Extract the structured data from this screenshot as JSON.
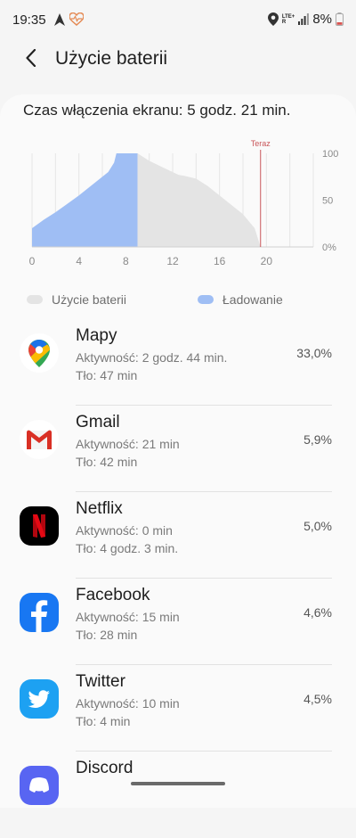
{
  "status_bar": {
    "time": "19:35",
    "network": "LTE+ R",
    "battery_percent": "8%",
    "icons": [
      "navigation-arrow-icon",
      "health-heart-icon",
      "location-icon",
      "signal-icon",
      "battery-low-icon"
    ]
  },
  "header": {
    "title": "Użycie baterii",
    "back_icon": "back-arrow-icon"
  },
  "screen_on": "Czas włączenia ekranu: 5 godz. 21 min.",
  "chart_data": {
    "type": "area",
    "x_ticks": [
      "0",
      "4",
      "8",
      "12",
      "16",
      "20"
    ],
    "y_ticks": [
      "100",
      "50",
      "0%"
    ],
    "xlim": [
      0,
      24
    ],
    "ylim": [
      0,
      100
    ],
    "now_label": "Teraz",
    "now_x": 19.5,
    "series": [
      {
        "name": "Ładowanie",
        "color": "#9fbef4",
        "x": [
          0,
          1,
          2,
          3,
          4,
          5,
          6,
          6.5,
          7,
          7.2,
          9
        ],
        "y": [
          20,
          29,
          37,
          46,
          55,
          65,
          75,
          80,
          90,
          100,
          100
        ]
      },
      {
        "name": "Użycie baterii",
        "color": "#e4e4e4",
        "x": [
          9,
          10,
          11,
          11.5,
          12,
          12.5,
          13,
          14,
          15,
          16,
          17,
          18,
          19,
          19.5
        ],
        "y": [
          100,
          92,
          86,
          83,
          80,
          77,
          76,
          73,
          65,
          55,
          45,
          35,
          20,
          0
        ]
      }
    ]
  },
  "legend": [
    {
      "label": "Użycie baterii",
      "color": "#e4e4e4"
    },
    {
      "label": "Ładowanie",
      "color": "#9fbef4"
    }
  ],
  "apps": [
    {
      "name": "Mapy",
      "active": "Aktywność: 2 godz. 44 min.",
      "background": "Tło: 47 min",
      "percent": "33,0%",
      "icon": "google-maps-icon"
    },
    {
      "name": "Gmail",
      "active": "Aktywność: 21 min",
      "background": "Tło: 42 min",
      "percent": "5,9%",
      "icon": "gmail-icon"
    },
    {
      "name": "Netflix",
      "active": "Aktywność: 0 min",
      "background": "Tło: 4 godz. 3 min.",
      "percent": "5,0%",
      "icon": "netflix-icon"
    },
    {
      "name": "Facebook",
      "active": "Aktywność: 15 min",
      "background": "Tło: 28 min",
      "percent": "4,6%",
      "icon": "facebook-icon"
    },
    {
      "name": "Twitter",
      "active": "Aktywność: 10 min",
      "background": "Tło: 4 min",
      "percent": "4,5%",
      "icon": "twitter-icon"
    },
    {
      "name": "Discord",
      "icon": "discord-icon"
    }
  ]
}
